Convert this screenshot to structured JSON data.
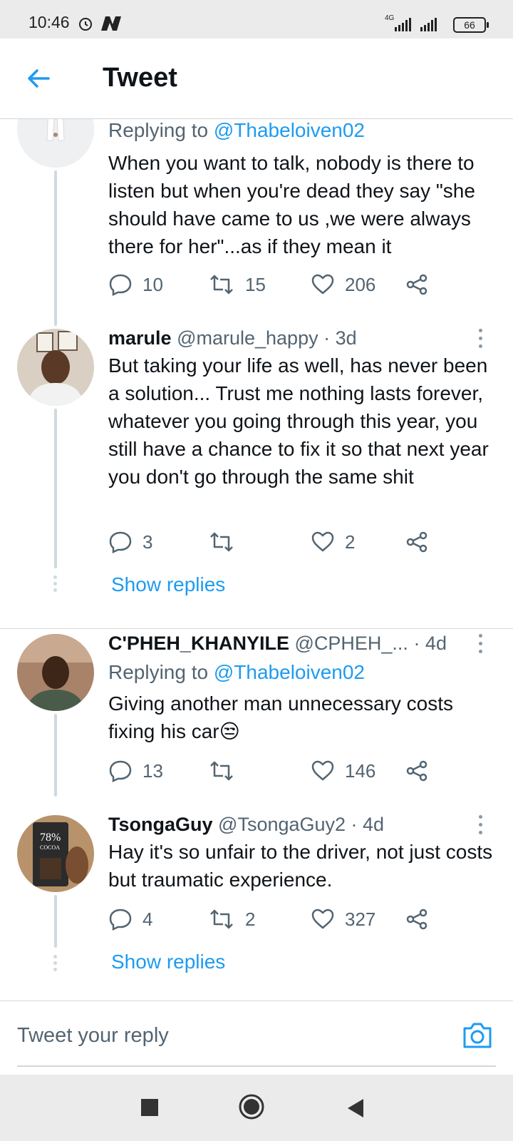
{
  "status_bar": {
    "time": "10:46",
    "network": "4G",
    "battery": "66"
  },
  "header": {
    "title": "Tweet"
  },
  "tweets": [
    {
      "replying_prefix": "Replying to ",
      "replying_handle": "@Thabeloiven02",
      "text": "When you want to talk, nobody is there to listen but when you're dead they say \"she should have came to us ,we were always there for her\"...as if they mean it",
      "reply_count": "10",
      "retweet_count": "15",
      "like_count": "206"
    },
    {
      "name": "marule",
      "handle": "@marule_happy",
      "time": " · 3d",
      "text": "But taking your life as well, has never been a solution... Trust me nothing lasts forever, whatever you going through this year, you still have a chance to fix it so that next year you don't go through the same shit",
      "reply_count": "3",
      "retweet_count": "",
      "like_count": "2",
      "show_replies": "Show replies"
    },
    {
      "name": "C'PHEH_KHANYILE",
      "handle": "@CPHEH_...",
      "time": " · 4d",
      "replying_prefix": "Replying to ",
      "replying_handle": "@Thabeloiven02",
      "text": "Giving another man unnecessary costs fixing his car😒",
      "reply_count": "13",
      "retweet_count": "",
      "like_count": "146"
    },
    {
      "name": "TsongaGuy",
      "handle": "@TsongaGuy2",
      "time": " · 4d",
      "text": "Hay it's so unfair to the driver,  not just costs but traumatic experience.",
      "reply_count": "4",
      "retweet_count": "2",
      "like_count": "327",
      "show_replies": "Show replies",
      "avatar_label_big": "78%",
      "avatar_label_small": "COCOA"
    }
  ],
  "compose": {
    "placeholder": "Tweet your reply"
  },
  "colors": {
    "accent": "#1d9bf0",
    "text": "#0f1419",
    "muted": "#536471",
    "thread": "#cfd9de"
  },
  "icons": [
    "back-arrow-icon",
    "reply-icon",
    "retweet-icon",
    "like-icon",
    "share-icon",
    "more-icon",
    "camera-icon",
    "nav-recents-icon",
    "nav-home-icon",
    "nav-back-icon"
  ]
}
